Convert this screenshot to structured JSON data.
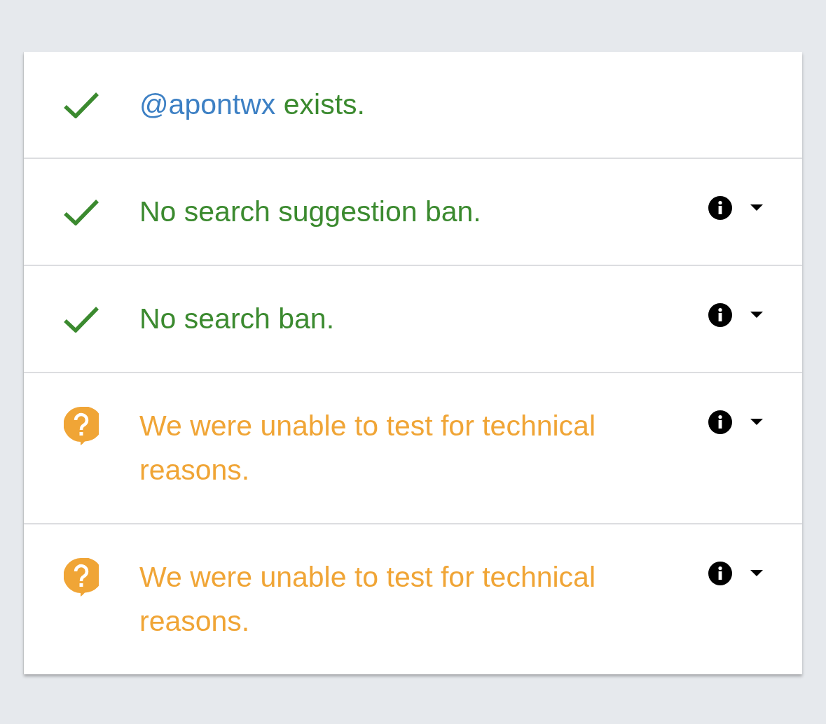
{
  "results": [
    {
      "kind": "pass",
      "mention": "@apontwx",
      "text": "exists.",
      "details": false
    },
    {
      "kind": "pass",
      "text": "No search suggestion ban.",
      "details": true
    },
    {
      "kind": "pass",
      "text": "No search ban.",
      "details": true
    },
    {
      "kind": "unknown",
      "text": "We were unable to test for technical reasons.",
      "details": true
    },
    {
      "kind": "unknown",
      "text": "We were unable to test for technical reasons.",
      "details": true
    }
  ]
}
